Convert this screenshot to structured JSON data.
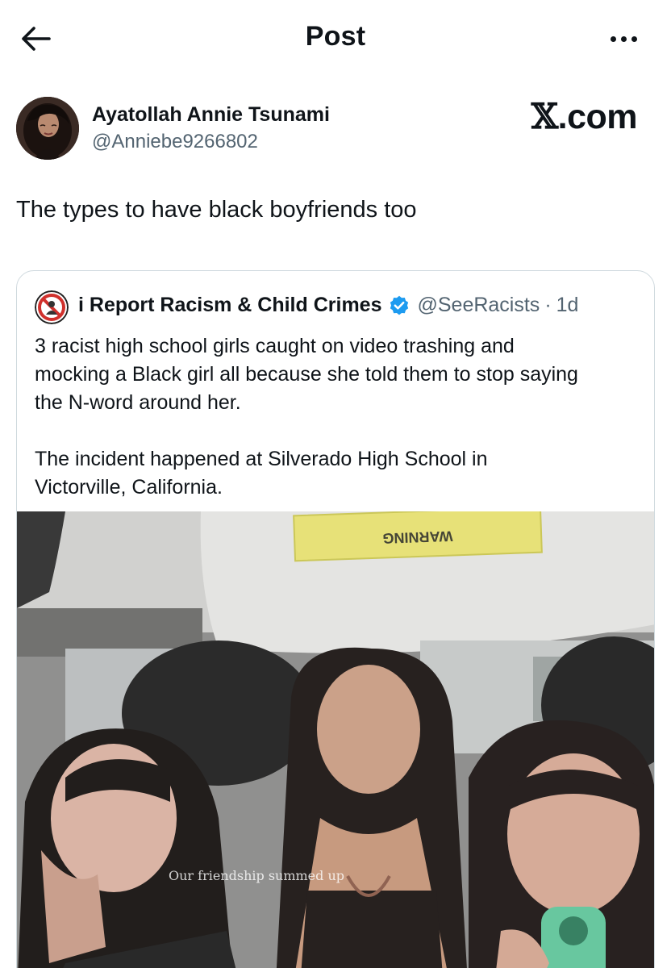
{
  "header": {
    "title": "Post"
  },
  "author": {
    "name": "Ayatollah Annie Tsunami",
    "handle": "@Anniebe9266802"
  },
  "watermark": {
    "logo": "𝕏",
    "text": ".com"
  },
  "post": {
    "text": "The types to have black boyfriends too"
  },
  "quote": {
    "name": "i Report Racism & Child Crimes",
    "verified": true,
    "handle": "@SeeRacists",
    "separator": "·",
    "time": "1d",
    "text": "3 racist high school girls caught on video trashing and\nmocking a Black girl all because she told them to stop saying\nthe N-word around her.\n\nThe incident happened at Silverado High School in\nVictorville, California.",
    "media": {
      "sign_text": "WARNING",
      "caption": "Our friendship summed up"
    }
  },
  "icons": {
    "back": "arrow-left-icon",
    "more": "ellipsis-icon",
    "verified": "verified-badge-icon"
  },
  "colors": {
    "text": "#0f1419",
    "secondary": "#536471",
    "border": "#cfd9de",
    "verified": "#1d9bf0"
  }
}
